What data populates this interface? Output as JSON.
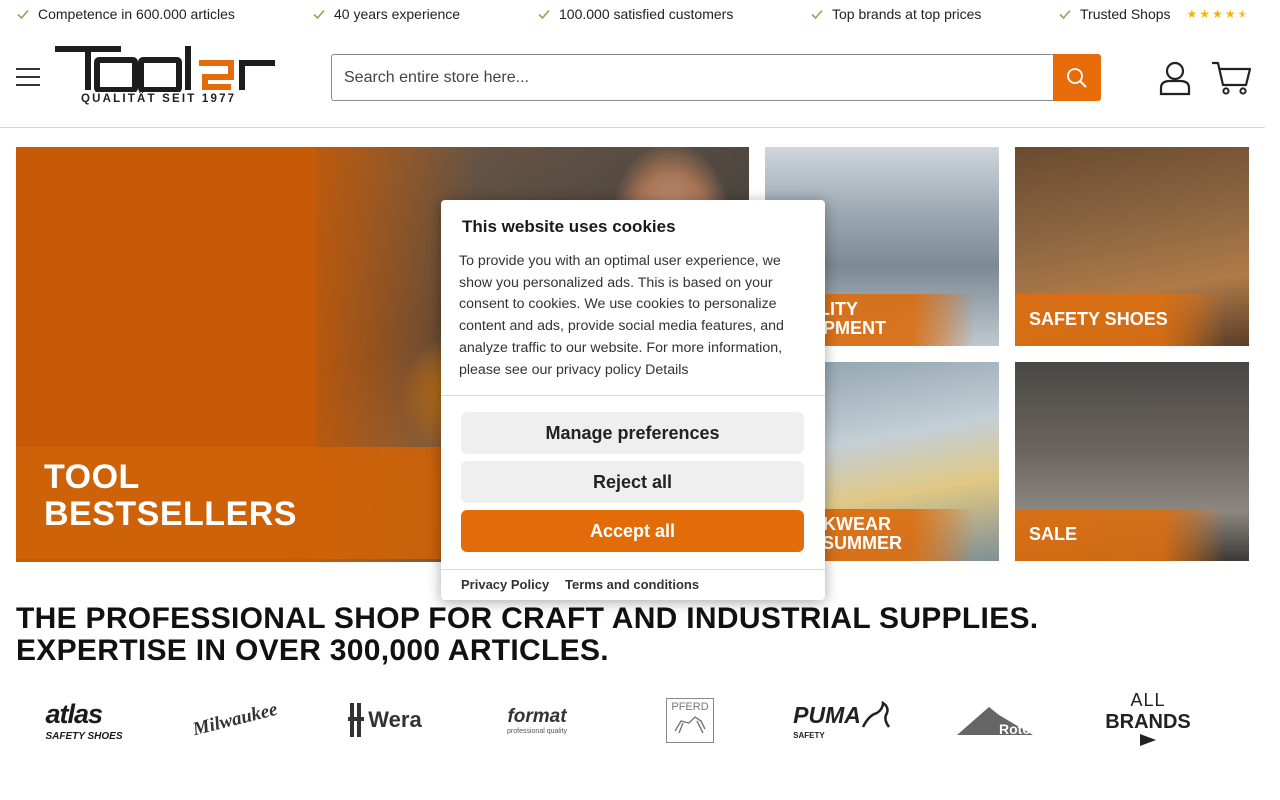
{
  "usp": [
    {
      "text": "Competence in 600.000 articles"
    },
    {
      "text": "40 years experience"
    },
    {
      "text": "100.000 satisfied customers"
    },
    {
      "text": "Top brands at top prices"
    },
    {
      "text": "Trusted Shops"
    }
  ],
  "trusted_shops_rating": 4.5,
  "logo": {
    "brand": "Tooler",
    "tagline": "QUALITÄT SEIT 1977"
  },
  "search": {
    "placeholder": "Search entire store here..."
  },
  "banners": {
    "main": {
      "line1": "TOOL",
      "line2": "BESTSELLERS"
    },
    "tile1": {
      "line1": "QUALITY",
      "line2": "EQUIPMENT"
    },
    "tile2": {
      "line1": "SAFETY SHOES",
      "line2": ""
    },
    "tile3": {
      "line1": "WORKWEAR",
      "line2": "FOR SUMMER"
    },
    "tile4": {
      "line1": "SALE",
      "line2": ""
    }
  },
  "headline": {
    "line1": "THE PROFESSIONAL SHOP FOR CRAFT AND INDUSTRIAL SUPPLIES.",
    "line2": "EXPERTISE IN OVER 300,000 ARTICLES."
  },
  "brands": [
    {
      "name": "atlas",
      "sub": "SAFETY SHOES"
    },
    {
      "name": "Milwaukee",
      "sub": ""
    },
    {
      "name": "Wera",
      "sub": ""
    },
    {
      "name": "format",
      "sub": "professional quality"
    },
    {
      "name": "PFERD",
      "sub": ""
    },
    {
      "name": "PUMA",
      "sub": "SAFETY"
    },
    {
      "name": "Roto",
      "sub": ""
    },
    {
      "name": "ALL",
      "sub": "BRANDS"
    }
  ],
  "cookie": {
    "title": "This website uses cookies",
    "body": "To provide you with an optimal user experience, we show you personalized ads. This is based on your consent to cookies. We use cookies to personalize content and ads, provide social media features, and analyze traffic to our website. For more information, please see our ",
    "privacy_link": "privacy policy",
    "details_link": "Details",
    "manage_label": "Manage preferences",
    "reject_label": "Reject all",
    "accept_label": "Accept all",
    "privacy_policy_label": "Privacy Policy",
    "terms_label": "Terms and conditions"
  },
  "colors": {
    "accent": "#e36c0a",
    "check": "#6aa84f"
  }
}
